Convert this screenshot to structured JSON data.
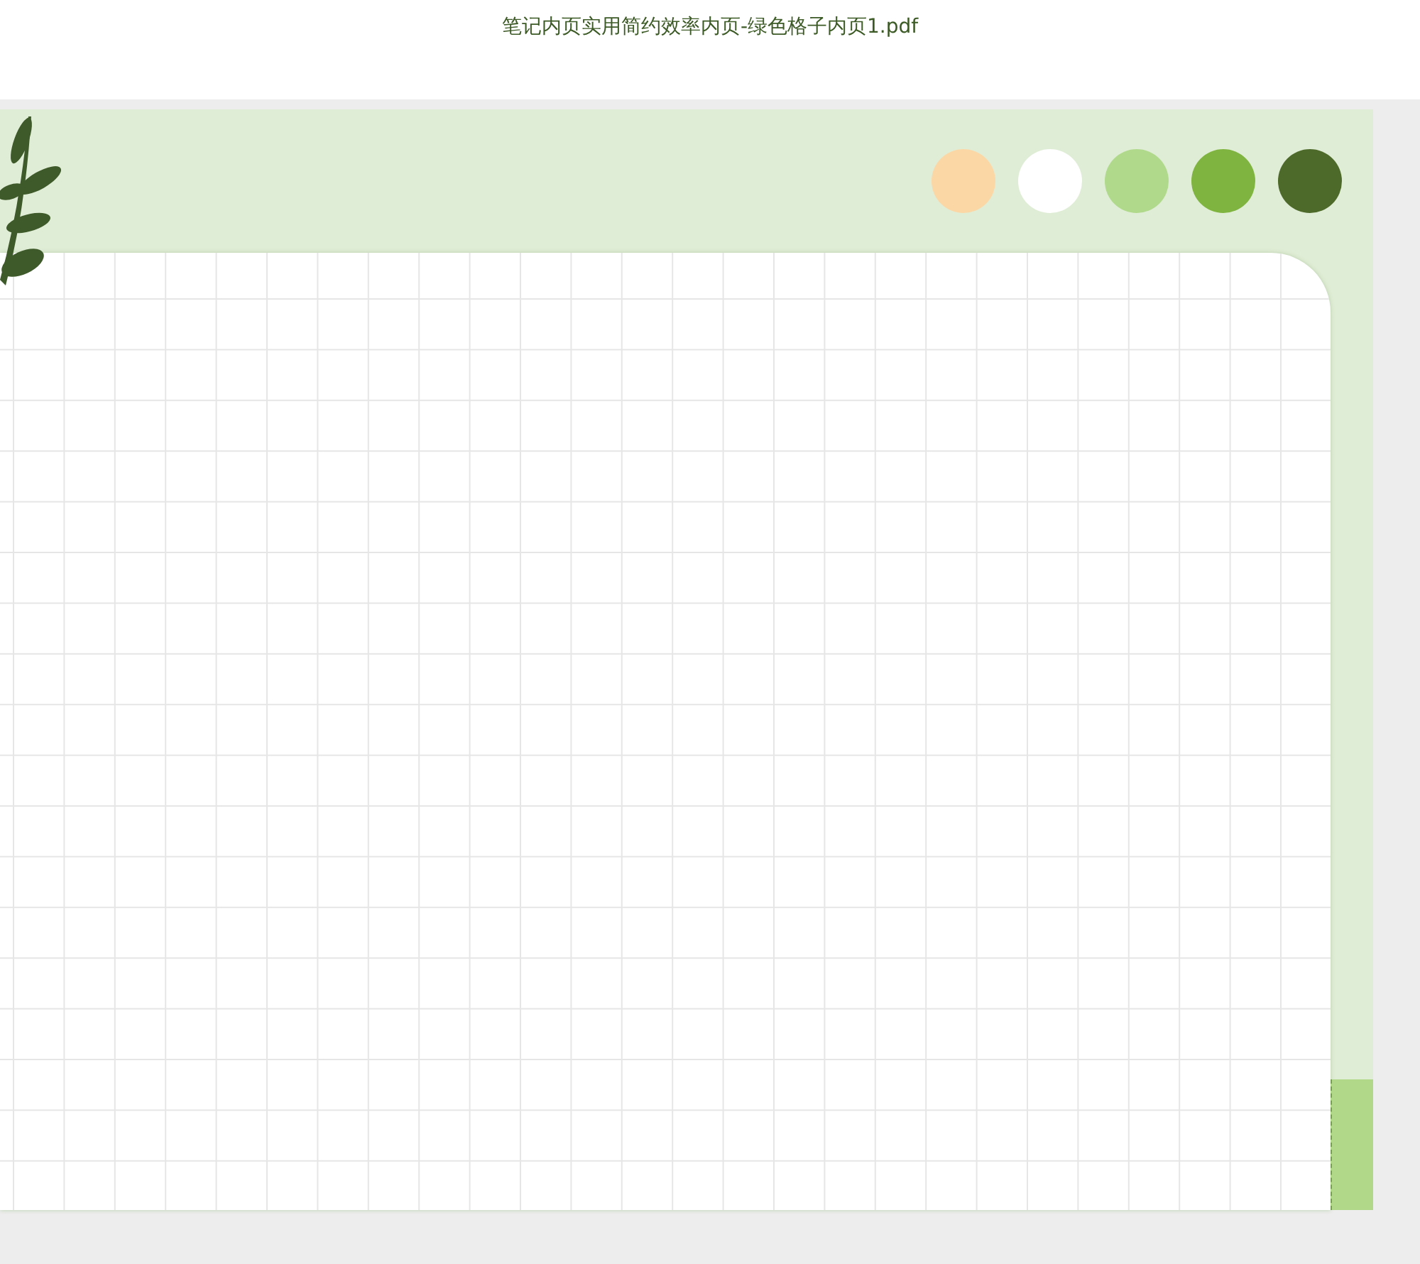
{
  "window": {
    "title": "笔记内页实用简约效率内页-绿色格子内页1.pdf"
  },
  "swatches": [
    {
      "color": "#fcd7a6"
    },
    {
      "color": "#ffffff"
    },
    {
      "color": "#b0d98c"
    },
    {
      "color": "#80b440"
    },
    {
      "color": "#4e6a2a"
    }
  ]
}
